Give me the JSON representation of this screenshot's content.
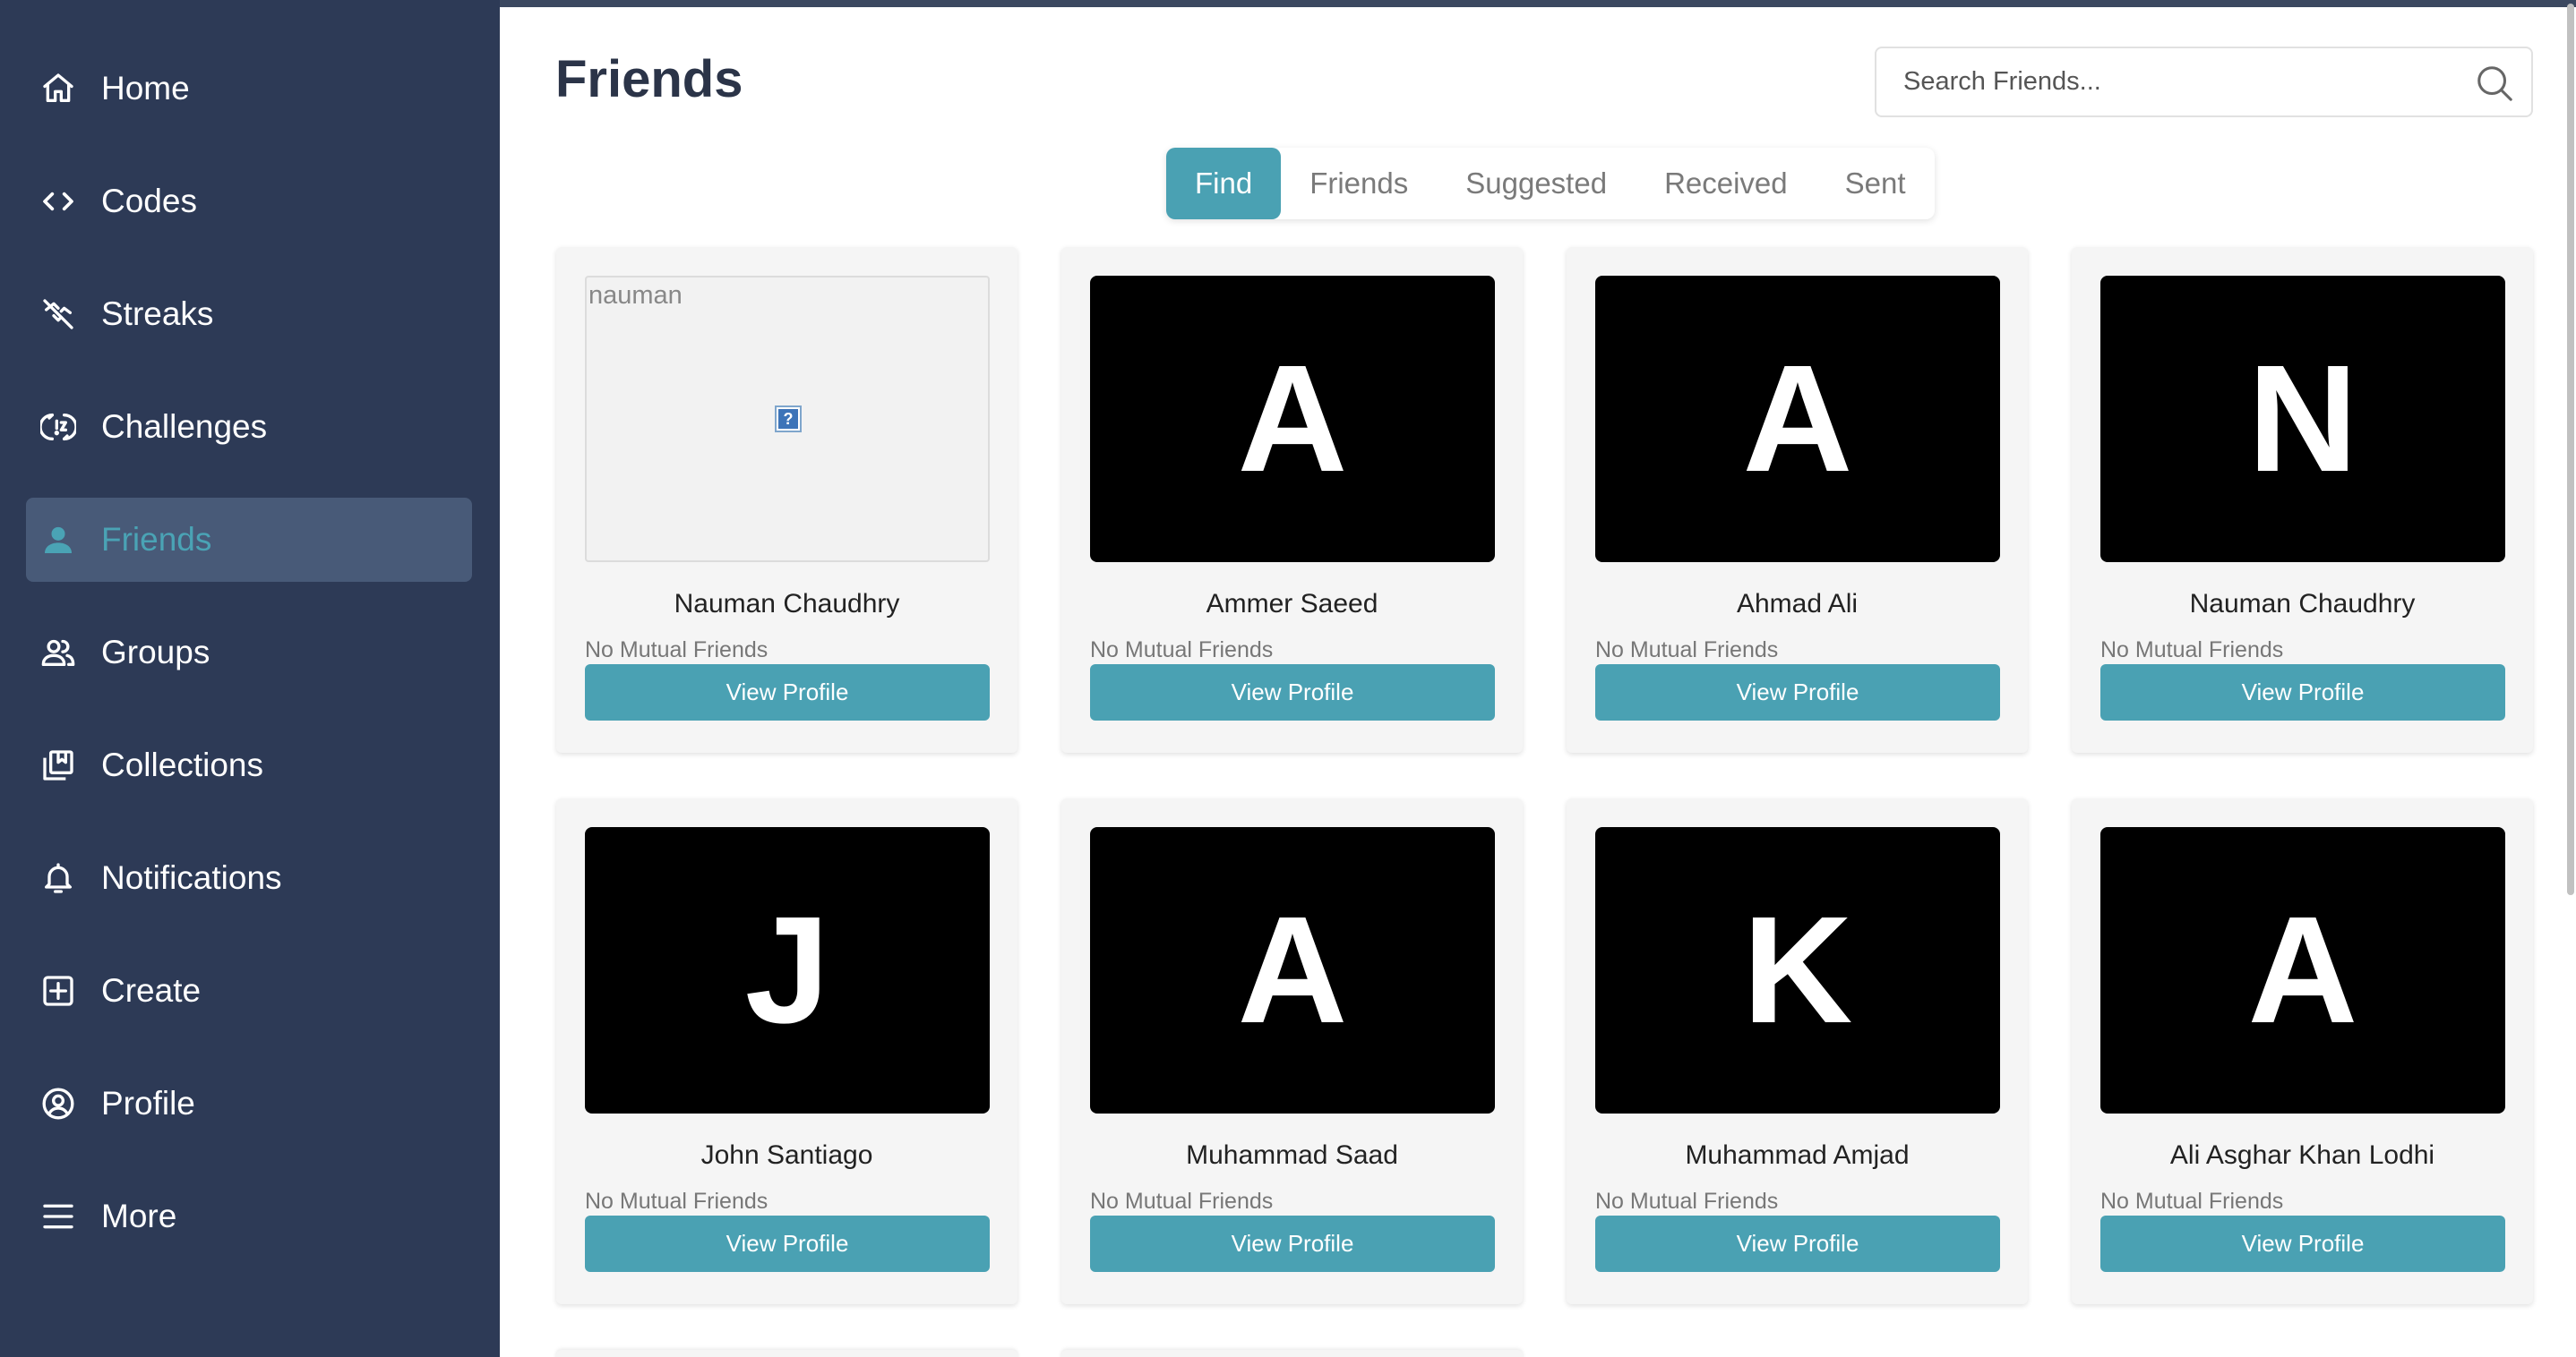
{
  "sidebar": {
    "items": [
      {
        "label": "Home",
        "icon": "home-icon",
        "active": false
      },
      {
        "label": "Codes",
        "icon": "code-icon",
        "active": false
      },
      {
        "label": "Streaks",
        "icon": "streak-off-icon",
        "active": false
      },
      {
        "label": "Challenges",
        "icon": "challenge-icon",
        "active": false
      },
      {
        "label": "Friends",
        "icon": "person-icon",
        "active": true
      },
      {
        "label": "Groups",
        "icon": "groups-icon",
        "active": false
      },
      {
        "label": "Collections",
        "icon": "collections-icon",
        "active": false
      },
      {
        "label": "Notifications",
        "icon": "bell-icon",
        "active": false
      },
      {
        "label": "Create",
        "icon": "plus-square-icon",
        "active": false
      },
      {
        "label": "Profile",
        "icon": "profile-circle-icon",
        "active": false
      },
      {
        "label": "More",
        "icon": "menu-icon",
        "active": false
      }
    ]
  },
  "header": {
    "title": "Friends",
    "search_placeholder": "Search Friends..."
  },
  "tabs": [
    {
      "label": "Find",
      "active": true
    },
    {
      "label": "Friends",
      "active": false
    },
    {
      "label": "Suggested",
      "active": false
    },
    {
      "label": "Received",
      "active": false
    },
    {
      "label": "Sent",
      "active": false
    }
  ],
  "cards": [
    {
      "name": "Nauman Chaudhry",
      "initial": "",
      "image_alt": "nauman",
      "broken_image": true,
      "mutual": "No Mutual Friends",
      "button": "View Profile"
    },
    {
      "name": "Ammer Saeed",
      "initial": "A",
      "mutual": "No Mutual Friends",
      "button": "View Profile"
    },
    {
      "name": "Ahmad Ali",
      "initial": "A",
      "mutual": "No Mutual Friends",
      "button": "View Profile"
    },
    {
      "name": "Nauman Chaudhry",
      "initial": "N",
      "mutual": "No Mutual Friends",
      "button": "View Profile"
    },
    {
      "name": "John Santiago",
      "initial": "J",
      "mutual": "No Mutual Friends",
      "button": "View Profile"
    },
    {
      "name": "Muhammad Saad",
      "initial": "A",
      "mutual": "No Mutual Friends",
      "button": "View Profile"
    },
    {
      "name": "Muhammad Amjad",
      "initial": "K",
      "mutual": "No Mutual Friends",
      "button": "View Profile"
    },
    {
      "name": "Ali Asghar Khan Lodhi",
      "initial": "A",
      "mutual": "No Mutual Friends",
      "button": "View Profile"
    }
  ],
  "colors": {
    "sidebar_bg": "#2d3a56",
    "sidebar_active_bg": "#485a78",
    "accent": "#4aa1b3",
    "title": "#2b3448"
  }
}
